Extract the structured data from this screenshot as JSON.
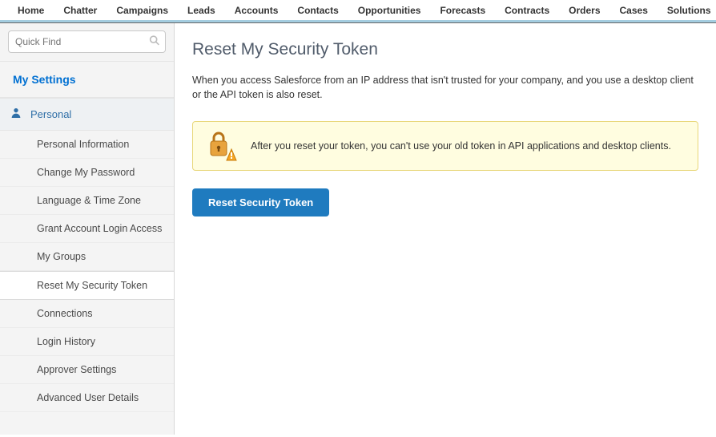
{
  "topnav": {
    "tabs": [
      "Home",
      "Chatter",
      "Campaigns",
      "Leads",
      "Accounts",
      "Contacts",
      "Opportunities",
      "Forecasts",
      "Contracts",
      "Orders",
      "Cases",
      "Solutions"
    ]
  },
  "sidebar": {
    "search_placeholder": "Quick Find",
    "heading": "My Settings",
    "group": {
      "label": "Personal",
      "items": [
        "Personal Information",
        "Change My Password",
        "Language & Time Zone",
        "Grant Account Login Access",
        "My Groups",
        "Reset My Security Token",
        "Connections",
        "Login History",
        "Approver Settings",
        "Advanced User Details"
      ],
      "active_index": 5
    }
  },
  "main": {
    "title": "Reset My Security Token",
    "description": "When you access Salesforce from an IP address that isn't trusted for your company, and you use a desktop client or the API token is also reset.",
    "alert": "After you reset your token, you can't use your old token in API applications and desktop clients.",
    "button_label": "Reset Security Token"
  }
}
